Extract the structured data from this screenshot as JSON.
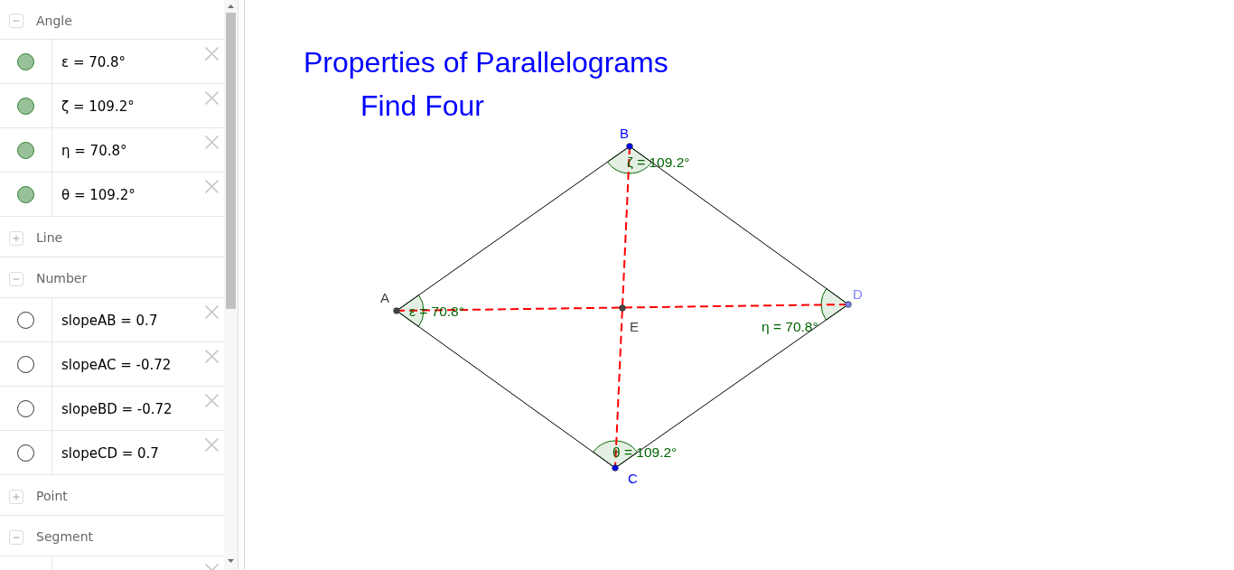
{
  "algebra_view": {
    "groups": [
      {
        "label": "Angle",
        "expanded": true,
        "items": [
          {
            "text": "ε = 70.8°",
            "visible": true
          },
          {
            "text": "ζ = 109.2°",
            "visible": true
          },
          {
            "text": "η = 70.8°",
            "visible": true
          },
          {
            "text": "θ = 109.2°",
            "visible": true
          }
        ]
      },
      {
        "label": "Line",
        "expanded": false
      },
      {
        "label": "Number",
        "expanded": true,
        "items": [
          {
            "text": "slopeAB = 0.7",
            "visible": false
          },
          {
            "text": "slopeAC = -0.72",
            "visible": false
          },
          {
            "text": "slopeBD = -0.72",
            "visible": false
          },
          {
            "text": "slopeCD = 0.7",
            "visible": false
          }
        ]
      },
      {
        "label": "Point",
        "expanded": false
      },
      {
        "label": "Segment",
        "expanded": true
      }
    ]
  },
  "graphics_view": {
    "titles": [
      "Properties of Parallelograms",
      "Find Four"
    ],
    "points": [
      {
        "label": "A",
        "color": "#444444"
      },
      {
        "label": "B",
        "color": "#0000ff"
      },
      {
        "label": "C",
        "color": "#0000ff"
      },
      {
        "label": "D",
        "color": "#8080ff"
      },
      {
        "label": "E",
        "color": "#444444"
      }
    ],
    "angle_labels": [
      "ε = 70.8°",
      "ζ = 109.2°",
      "η = 70.8°",
      "θ = 109.2°"
    ]
  }
}
